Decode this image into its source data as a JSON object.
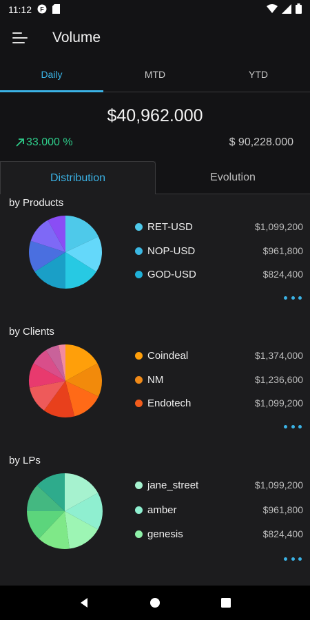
{
  "status_bar": {
    "time": "11:12"
  },
  "app_bar": {
    "title": "Volume"
  },
  "period_tabs": [
    {
      "label": "Daily",
      "active": true
    },
    {
      "label": "MTD",
      "active": false
    },
    {
      "label": "YTD",
      "active": false
    }
  ],
  "summary": {
    "total": "$40,962.000",
    "change": "33.000 %",
    "previous": "$ 90,228.000"
  },
  "view_tabs": [
    {
      "label": "Distribution",
      "active": true
    },
    {
      "label": "Evolution",
      "active": false
    }
  ],
  "sections": [
    {
      "title": "by Products",
      "slices": [
        {
          "color": "#4ec9ea",
          "value": 0.18
        },
        {
          "color": "#64d8fa",
          "value": 0.16
        },
        {
          "color": "#27c9e3",
          "value": 0.16
        },
        {
          "color": "#1a9fc7",
          "value": 0.16
        },
        {
          "color": "#4a6fe0",
          "value": 0.14
        },
        {
          "color": "#7e69f6",
          "value": 0.12
        },
        {
          "color": "#8a4df5",
          "value": 0.08
        }
      ],
      "legend": [
        {
          "name": "RET-USD",
          "value": "$1,099,200",
          "color": "#4ec9ea"
        },
        {
          "name": "NOP-USD",
          "value": "$961,800",
          "color": "#3bb8e3"
        },
        {
          "name": "GOD-USD",
          "value": "$824,400",
          "color": "#1fb0d8"
        }
      ]
    },
    {
      "title": "by Clients",
      "slices": [
        {
          "color": "#ff9f0a",
          "value": 0.17
        },
        {
          "color": "#f28a0b",
          "value": 0.15
        },
        {
          "color": "#ff6a17",
          "value": 0.14
        },
        {
          "color": "#e8401c",
          "value": 0.14
        },
        {
          "color": "#ee5a5a",
          "value": 0.12
        },
        {
          "color": "#e83a6e",
          "value": 0.11
        },
        {
          "color": "#d94e8a",
          "value": 0.08
        },
        {
          "color": "#c9629a",
          "value": 0.06
        },
        {
          "color": "#f28ba0",
          "value": 0.03
        }
      ],
      "legend": [
        {
          "name": "Coindeal",
          "value": "$1,374,000",
          "color": "#ff9f0a"
        },
        {
          "name": "NM",
          "value": "$1,236,600",
          "color": "#f08a18"
        },
        {
          "name": "Endotech",
          "value": "$1,099,200",
          "color": "#f25c1c"
        }
      ]
    },
    {
      "title": "by LPs",
      "slices": [
        {
          "color": "#a6f2cf",
          "value": 0.17
        },
        {
          "color": "#8fefd0",
          "value": 0.16
        },
        {
          "color": "#9df5b4",
          "value": 0.15
        },
        {
          "color": "#7fe888",
          "value": 0.14
        },
        {
          "color": "#5cd57c",
          "value": 0.13
        },
        {
          "color": "#44b881",
          "value": 0.12
        },
        {
          "color": "#2eab8c",
          "value": 0.13
        }
      ],
      "legend": [
        {
          "name": "jane_street",
          "value": "$1,099,200",
          "color": "#a6f2cf"
        },
        {
          "name": "amber",
          "value": "$961,800",
          "color": "#8fefd0"
        },
        {
          "name": "genesis",
          "value": "$824,400",
          "color": "#8ef0a8"
        }
      ]
    }
  ],
  "nav": [
    "back-icon",
    "home-icon",
    "recents-icon"
  ]
}
